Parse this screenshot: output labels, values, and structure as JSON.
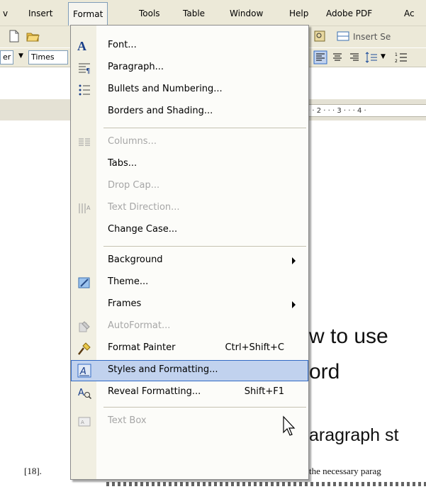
{
  "menubar": {
    "items": [
      {
        "label": "v"
      },
      {
        "label": "Insert"
      },
      {
        "label": "Format"
      },
      {
        "label": "Tools"
      },
      {
        "label": "Table"
      },
      {
        "label": "Window"
      },
      {
        "label": "Help"
      },
      {
        "label": "Adobe PDF"
      },
      {
        "label": "Ac"
      }
    ]
  },
  "toolbar": {
    "insert_label": "Insert Se",
    "style_value": "er",
    "font_value": "Times",
    "ruler_text": "· · 2 · · · 3 · · · 4 ·"
  },
  "format_menu": {
    "items": [
      {
        "label": "Font...",
        "icon": "font-a-icon"
      },
      {
        "label": "Paragraph...",
        "icon": "paragraph-icon"
      },
      {
        "label": "Bullets and Numbering...",
        "icon": "bullets-icon"
      },
      {
        "label": "Borders and Shading..."
      },
      {
        "label": "Columns...",
        "icon": "columns-icon",
        "disabled": true
      },
      {
        "label": "Tabs..."
      },
      {
        "label": "Drop Cap...",
        "disabled": true
      },
      {
        "label": "Text Direction...",
        "icon": "text-direction-icon",
        "disabled": true
      },
      {
        "label": "Change Case..."
      },
      {
        "label": "Background",
        "submenu": true
      },
      {
        "label": "Theme...",
        "icon": "theme-icon"
      },
      {
        "label": "Frames",
        "submenu": true
      },
      {
        "label": "AutoFormat...",
        "icon": "autoformat-icon",
        "disabled": true
      },
      {
        "label": "Format Painter",
        "icon": "format-painter-icon",
        "shortcut": "Ctrl+Shift+C"
      },
      {
        "label": "Styles and Formatting...",
        "icon": "styles-icon",
        "highlighted": true
      },
      {
        "label": "Reveal Formatting...",
        "icon": "reveal-formatting-icon",
        "shortcut": "Shift+F1"
      },
      {
        "label": "Text Box",
        "icon": "text-box-icon",
        "disabled": true
      }
    ]
  },
  "document": {
    "line1": "w to use",
    "line2": "ord",
    "line3": "aragraph st",
    "ref": "[18].",
    "body_text": "the necessary parag"
  }
}
